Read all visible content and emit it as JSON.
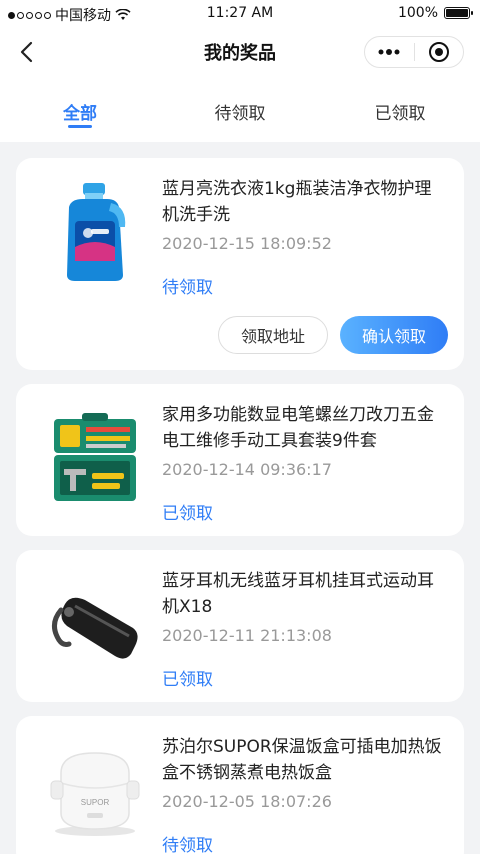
{
  "status_bar": {
    "carrier": "中国移动",
    "time": "11:27 AM",
    "battery": "100%",
    "battery_level": 1.0
  },
  "nav": {
    "title": "我的奖品"
  },
  "tabs": [
    {
      "label": "全部",
      "active": true
    },
    {
      "label": "待领取",
      "active": false
    },
    {
      "label": "已领取",
      "active": false
    }
  ],
  "prizes": [
    {
      "name": "蓝月亮洗衣液1kg瓶装洁净衣物护理机洗手洗",
      "time": "2020-12-15 18:09:52",
      "status": "待领取",
      "icon": "detergent-bottle",
      "actions": {
        "address": "领取地址",
        "confirm": "确认领取"
      }
    },
    {
      "name": "家用多功能数显电笔螺丝刀改刀五金电工维修手动工具套装9件套",
      "time": "2020-12-14 09:36:17",
      "status": "已领取",
      "icon": "toolbox"
    },
    {
      "name": "蓝牙耳机无线蓝牙耳机挂耳式运动耳机X18",
      "time": "2020-12-11 21:13:08",
      "status": "已领取",
      "icon": "bluetooth-earpiece"
    },
    {
      "name": "苏泊尔SUPOR保温饭盒可插电加热饭盒不锈钢蒸煮电热饭盒",
      "time": "2020-12-05 18:07:26",
      "status": "待领取",
      "icon": "lunch-box",
      "brand_mark": "SUPOR"
    }
  ],
  "colors": {
    "accent": "#2f7df6",
    "background": "#f2f3f5"
  }
}
